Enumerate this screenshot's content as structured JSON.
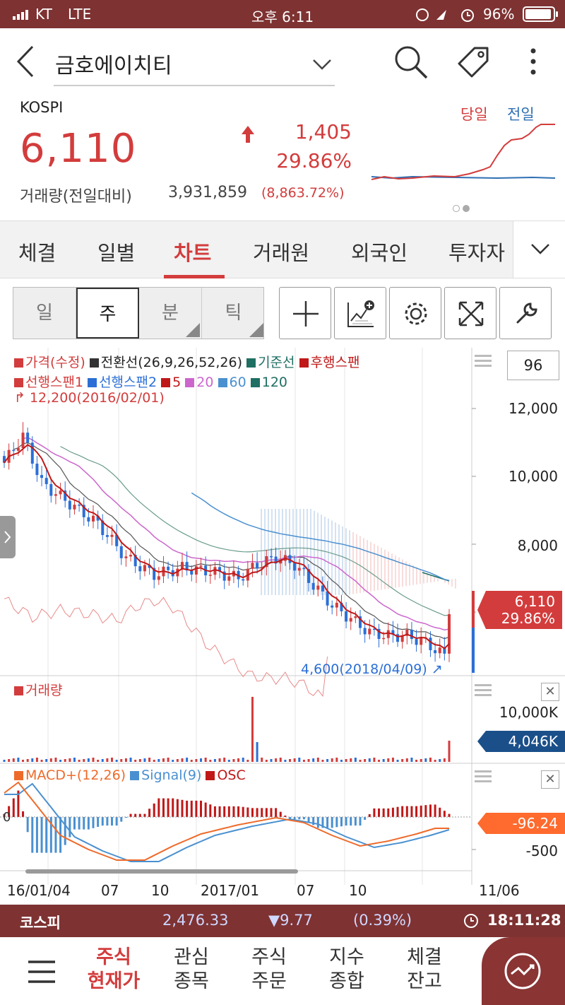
{
  "status_bar": {
    "carrier": "KT",
    "network": "LTE",
    "time": "오후 6:11",
    "battery": "96%"
  },
  "header": {
    "stock_name": "금호에이치티"
  },
  "summary": {
    "market": "KOSPI",
    "price": "6,110",
    "change": "1,405",
    "change_pct": "29.86%",
    "volume_label": "거래량(전일대비)",
    "volume": "3,931,859",
    "volume_pct": "(8,863.72%)",
    "mini_legend_today": "당일",
    "mini_legend_prev": "전일"
  },
  "tabs": [
    "체결",
    "일별",
    "차트",
    "거래원",
    "외국인",
    "투자자"
  ],
  "active_tab": "차트",
  "period_buttons": [
    "일",
    "주",
    "분",
    "틱"
  ],
  "active_period": "주",
  "chart": {
    "legend_line1": {
      "price": "가격(수정)",
      "conversion": "전환선(26,9,26,52,26)",
      "base": "기준선",
      "lagging": "후행스팬"
    },
    "legend_line2": {
      "lead1": "선행스팬1",
      "lead2": "선행스팬2",
      "ma5": "5",
      "ma20": "20",
      "ma60": "60",
      "ma120": "120"
    },
    "high_label": "12,200(2016/02/01)",
    "low_label": "4,600(2018/04/09)",
    "box_value": "96",
    "y_ticks": [
      "12,000",
      "10,000",
      "8,000"
    ],
    "price_tag_1": "6,110",
    "price_tag_2": "29.86%",
    "volume_label": "거래량",
    "volume_tick": "10,000K",
    "volume_tag": "4,046K",
    "macd_legend": {
      "macd": "MACD+(12,26)",
      "signal": "Signal(9)",
      "osc": "OSC"
    },
    "macd_zero": "0",
    "macd_tick": "-500",
    "macd_tag": "-96.24",
    "x_labels": [
      "16/01/04",
      "07",
      "10",
      "2017/01",
      "07",
      "10",
      "11/06"
    ],
    "colors": {
      "up": "#d33c3c",
      "down": "#2b6fd6",
      "ma20": "#cc66cc",
      "ma60": "#4a90d0",
      "ma120": "#1f6f63"
    }
  },
  "ticker": {
    "name": "코스피",
    "value": "2,476.33",
    "change": "▼9.77",
    "pct": "(0.39%)",
    "time": "18:11:28"
  },
  "bottom_nav": [
    {
      "line1": "주식",
      "line2": "현재가"
    },
    {
      "line1": "관심",
      "line2": "종목"
    },
    {
      "line1": "주식",
      "line2": "주문"
    },
    {
      "line1": "지수",
      "line2": "종합"
    },
    {
      "line1": "체결",
      "line2": "잔고"
    }
  ]
}
